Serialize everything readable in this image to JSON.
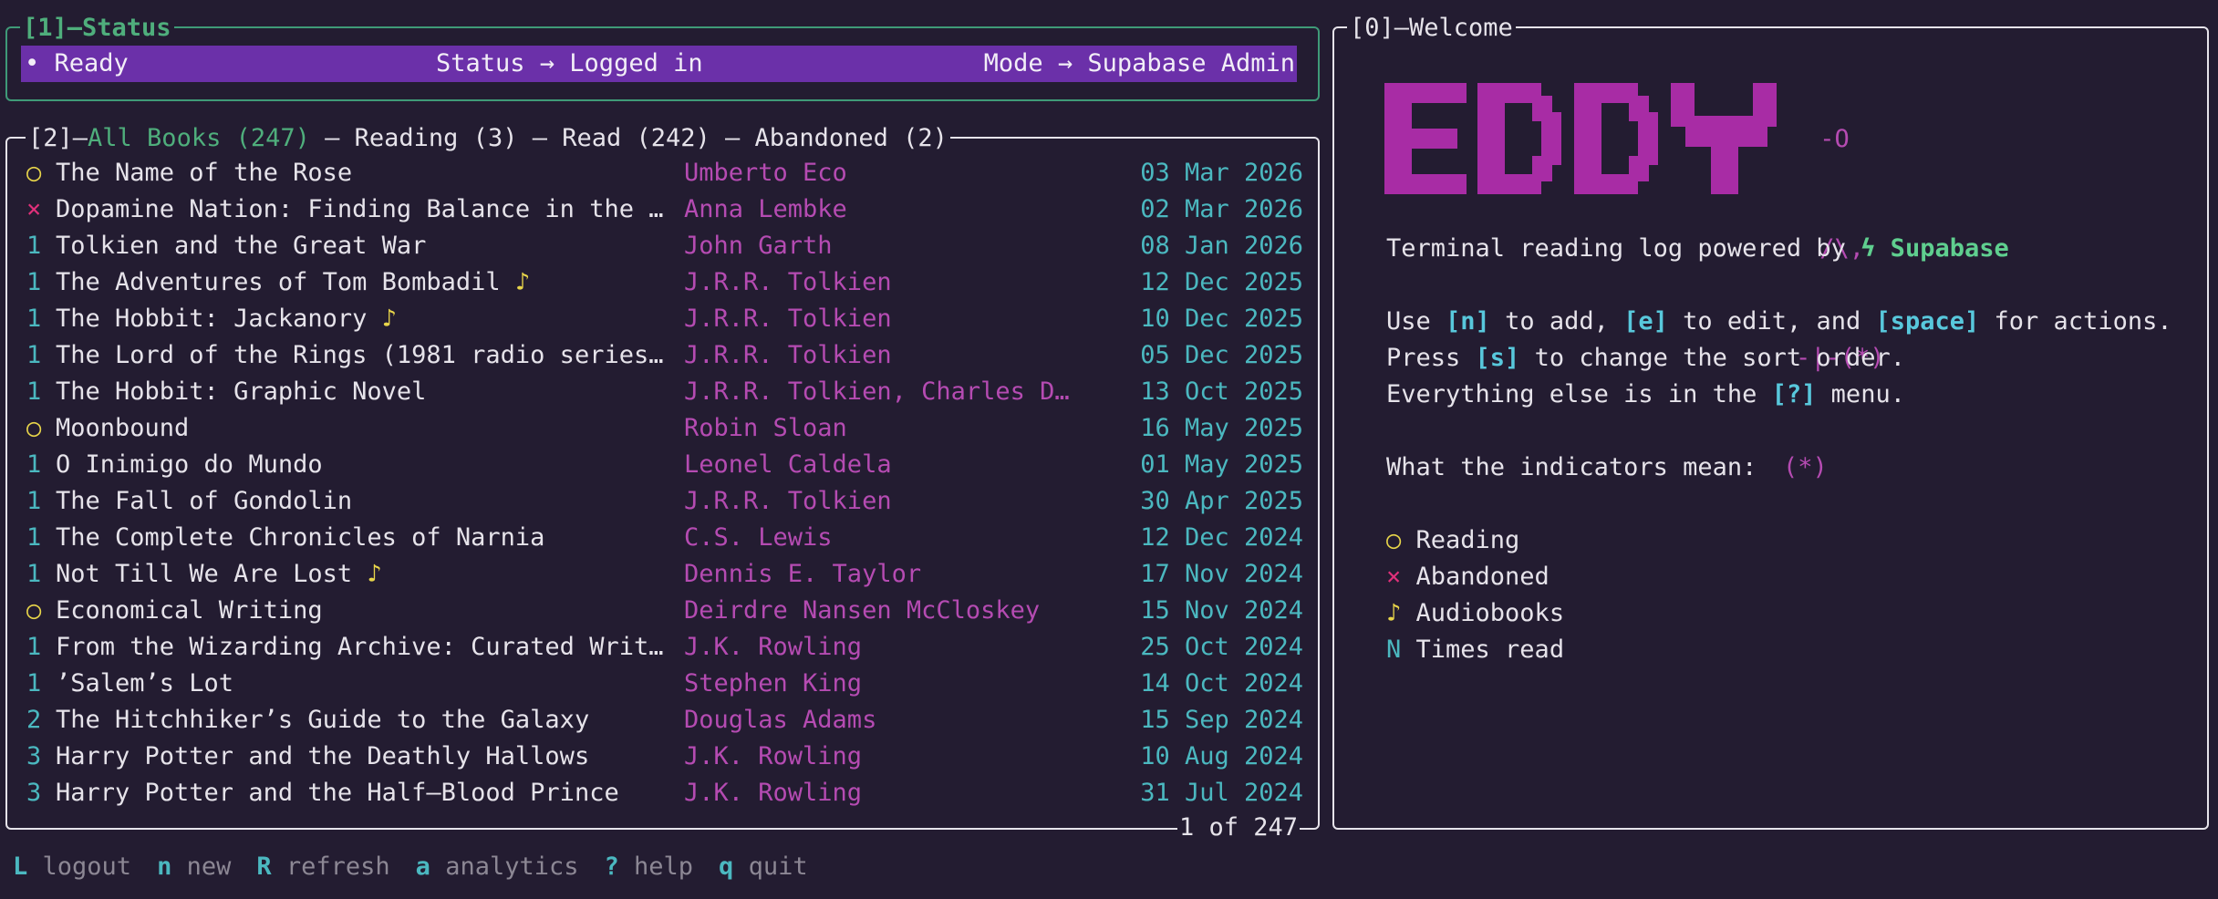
{
  "status": {
    "panel_title": "[1]—Status",
    "ready": "• Ready",
    "status_text": "Status → Logged in",
    "mode_text": "Mode → Supabase Admin"
  },
  "books": {
    "title_prefix": "[2]—",
    "tab_all": "All Books (247)",
    "tab_reading": " — Reading (3)",
    "tab_read": " — Read (242)",
    "tab_abandoned": " — Abandoned (2)",
    "pager": "1 of 247",
    "rows": [
      {
        "ind": "○",
        "ind_type": "reading",
        "title": "The Name of the Rose",
        "audio": "",
        "author": "Umberto Eco",
        "date": "03 Mar 2026"
      },
      {
        "ind": "×",
        "ind_type": "abandoned",
        "title": "Dopamine Nation: Finding Balance in the …",
        "audio": "",
        "author": "Anna Lembke",
        "date": "02 Mar 2026"
      },
      {
        "ind": "1",
        "ind_type": "count",
        "title": "Tolkien and the Great War",
        "audio": "",
        "author": "John Garth",
        "date": "08 Jan 2026"
      },
      {
        "ind": "1",
        "ind_type": "count",
        "title": "The Adventures of Tom Bombadil",
        "audio": "♪",
        "author": "J.R.R. Tolkien",
        "date": "12 Dec 2025"
      },
      {
        "ind": "1",
        "ind_type": "count",
        "title": "The Hobbit: Jackanory",
        "audio": "♪",
        "author": "J.R.R. Tolkien",
        "date": "10 Dec 2025"
      },
      {
        "ind": "1",
        "ind_type": "count",
        "title": "The Lord of the Rings (1981 radio series…",
        "audio": "",
        "author": "J.R.R. Tolkien",
        "date": "05 Dec 2025"
      },
      {
        "ind": "1",
        "ind_type": "count",
        "title": "The Hobbit: Graphic Novel",
        "audio": "",
        "author": "J.R.R. Tolkien, Charles D…",
        "date": "13 Oct 2025"
      },
      {
        "ind": "○",
        "ind_type": "reading",
        "title": "Moonbound",
        "audio": "",
        "author": "Robin Sloan",
        "date": "16 May 2025"
      },
      {
        "ind": "1",
        "ind_type": "count",
        "title": "O Inimigo do Mundo",
        "audio": "",
        "author": "Leonel Caldela",
        "date": "01 May 2025"
      },
      {
        "ind": "1",
        "ind_type": "count",
        "title": "The Fall of Gondolin",
        "audio": "",
        "author": "J.R.R. Tolkien",
        "date": "30 Apr 2025"
      },
      {
        "ind": "1",
        "ind_type": "count",
        "title": "The Complete Chronicles of Narnia",
        "audio": "",
        "author": "C.S. Lewis",
        "date": "12 Dec 2024"
      },
      {
        "ind": "1",
        "ind_type": "count",
        "title": "Not Till We Are Lost",
        "audio": "♪",
        "author": "Dennis E. Taylor",
        "date": "17 Nov 2024"
      },
      {
        "ind": "○",
        "ind_type": "reading",
        "title": "Economical Writing",
        "audio": "",
        "author": "Deirdre Nansen McCloskey",
        "date": "15 Nov 2024"
      },
      {
        "ind": "1",
        "ind_type": "count",
        "title": "From the Wizarding Archive: Curated Writ…",
        "audio": "",
        "author": "J.K. Rowling",
        "date": "25 Oct 2024"
      },
      {
        "ind": "1",
        "ind_type": "count",
        "title": "’Salem’s Lot",
        "audio": "",
        "author": "Stephen King",
        "date": "14 Oct 2024"
      },
      {
        "ind": "2",
        "ind_type": "count",
        "title": "The Hitchhiker’s Guide to the Galaxy",
        "audio": "",
        "author": "Douglas Adams",
        "date": "15 Sep 2024"
      },
      {
        "ind": "3",
        "ind_type": "count",
        "title": "Harry Potter and the Deathly Hallows",
        "audio": "",
        "author": "J.K. Rowling",
        "date": "10 Aug 2024"
      },
      {
        "ind": "3",
        "ind_type": "count",
        "title": "Harry Potter and the Half—Blood Prince",
        "audio": "",
        "author": "J.K. Rowling",
        "date": "31 Jul 2024"
      }
    ]
  },
  "welcome": {
    "panel_title": "[0]—Welcome",
    "logo_text": "EDDY",
    "ascii_figure": [
      " -O",
      " /\\,",
      "-|-(*)",
      "(*)"
    ],
    "tagline_prefix": "Terminal reading log powered by ",
    "tagline_brand": "ϟ Supabase",
    "help1_a": "Use ",
    "help1_k1": "[n]",
    "help1_b": " to add, ",
    "help1_k2": "[e]",
    "help1_c": " to edit, and ",
    "help1_k3": "[space]",
    "help1_d": " for actions.",
    "help2_a": "Press ",
    "help2_k": "[s]",
    "help2_b": " to change the sort order.",
    "help3_a": "Everything else is in the ",
    "help3_k": "[?]",
    "help3_b": " menu.",
    "legend_title": "What the indicators mean:",
    "legend": [
      {
        "sym": "○",
        "label": "Reading",
        "type": "reading"
      },
      {
        "sym": "×",
        "label": "Abandoned",
        "type": "abandoned"
      },
      {
        "sym": "♪",
        "label": "Audiobooks",
        "type": "audio"
      },
      {
        "sym": "N",
        "label": "Times read",
        "type": "count"
      }
    ]
  },
  "footer": [
    {
      "key": "L",
      "label": "logout"
    },
    {
      "key": "n",
      "label": "new"
    },
    {
      "key": "R",
      "label": "refresh"
    },
    {
      "key": "a",
      "label": "analytics"
    },
    {
      "key": "?",
      "label": "help"
    },
    {
      "key": "q",
      "label": "quit"
    }
  ],
  "colors": {
    "background": "#231c31",
    "status_bar": "#6b30a9",
    "accent_pink": "#b54bb2",
    "accent_cyan": "#4bb8c0",
    "accent_green": "#4fae7c",
    "yellow": "#e8d54a",
    "red": "#e0307a"
  }
}
